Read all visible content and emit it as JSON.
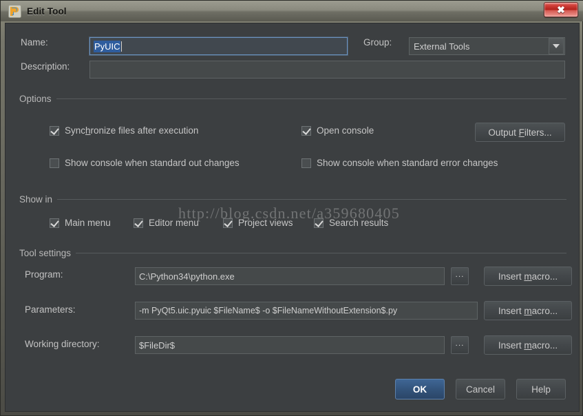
{
  "window": {
    "title": "Edit Tool",
    "icon": "pycharm-icon",
    "close_label": "✖"
  },
  "fields": {
    "name_label": "Name:",
    "name_value": "PyUIC",
    "name_selected": true,
    "group_label": "Group:",
    "group_value": "External Tools",
    "description_label": "Description:",
    "description_value": "",
    "description_placeholder": ""
  },
  "options": {
    "section_label": "Options",
    "checkboxes": [
      {
        "label_pre": "Sync",
        "mnemonic": "h",
        "label_post": "ronize files after execution",
        "checked": true
      },
      {
        "label_pre": "Open console",
        "mnemonic": "",
        "label_post": "",
        "checked": true
      },
      {
        "label_pre": "Show console when standard out changes",
        "mnemonic": "",
        "label_post": "",
        "checked": false
      },
      {
        "label_pre": "Show console when standard error changes",
        "mnemonic": "",
        "label_post": "",
        "checked": false
      }
    ],
    "output_filters_pre": "Output ",
    "output_filters_mn": "F",
    "output_filters_post": "ilters..."
  },
  "show_in": {
    "section_label": "Show in",
    "checkboxes": [
      {
        "label": "Main menu",
        "checked": true
      },
      {
        "label": "Editor menu",
        "checked": true
      },
      {
        "label": "Project views",
        "checked": true
      },
      {
        "label": "Search results",
        "checked": true
      }
    ]
  },
  "tool_settings": {
    "section_label": "Tool settings",
    "program_label": "Program:",
    "program_value": "C:\\Python34\\python.exe",
    "parameters_label": "Parameters:",
    "parameters_value": "-m PyQt5.uic.pyuic   $FileName$ -o $FileNameWithoutExtension$.py",
    "working_dir_label": "Working directory:",
    "working_dir_value": "$FileDir$",
    "browse_label": "...",
    "insert_macro_pre": "Insert ",
    "insert_macro_mn": "m",
    "insert_macro_post": "acro..."
  },
  "footer": {
    "ok_label": "OK",
    "cancel_label": "Cancel",
    "help_label": "Help"
  },
  "watermark": {
    "text": "http://blog.csdn.net/a359680405"
  },
  "colors": {
    "dialog_bg": "#3c3f41",
    "field_bg": "#45494a",
    "focus_border": "#6b93c0",
    "selection_bg": "#2f5d9e",
    "primary_button": "#325279",
    "close_button": "#b11f19",
    "titlebar": "#8a8a7e"
  }
}
